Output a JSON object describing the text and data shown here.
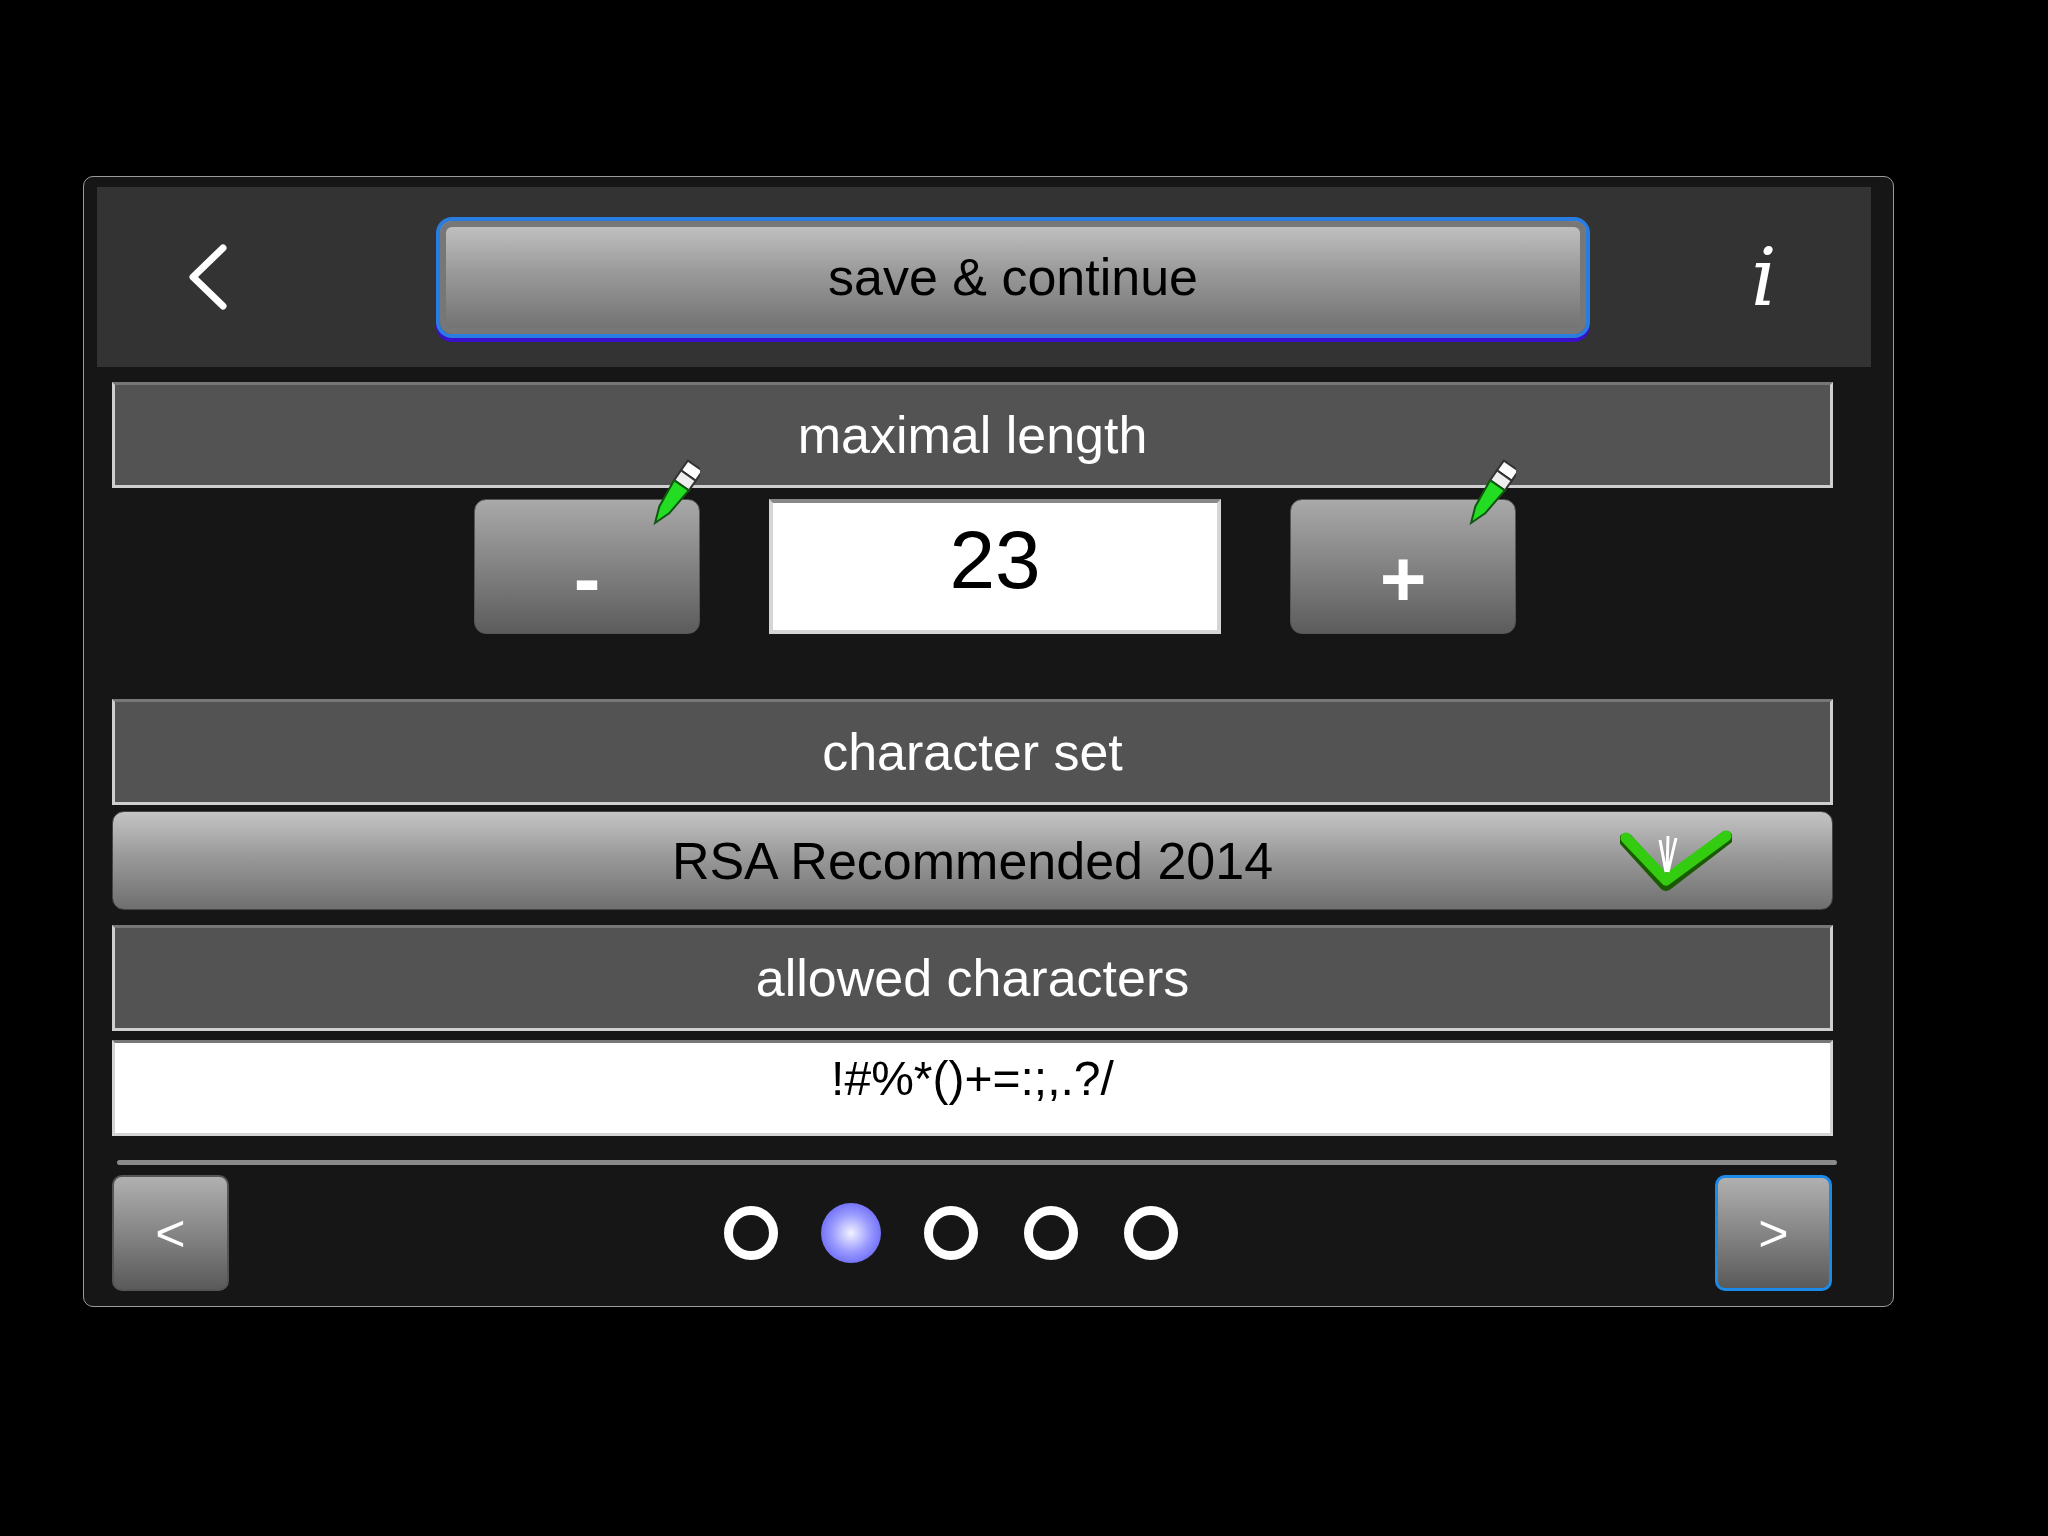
{
  "top_bar": {
    "primary_button": {
      "label": "save & continue",
      "focused": true
    },
    "info_label": "i"
  },
  "sections": [
    {
      "kind": "stepper",
      "header": "maximal length",
      "decrement": "-",
      "value": "23",
      "increment": "+"
    },
    {
      "kind": "dropdown",
      "header": "character set",
      "value": "RSA Recommended 2014"
    },
    {
      "kind": "text",
      "header": "allowed characters",
      "value": "!#%*()+=:;,.?/"
    }
  ],
  "pager": {
    "prev": {
      "label": "<",
      "focused": false
    },
    "next": {
      "label": ">",
      "focused": true
    },
    "pages": [
      {
        "selected": false
      },
      {
        "selected": true
      },
      {
        "selected": false
      },
      {
        "selected": false
      },
      {
        "selected": false
      }
    ]
  }
}
